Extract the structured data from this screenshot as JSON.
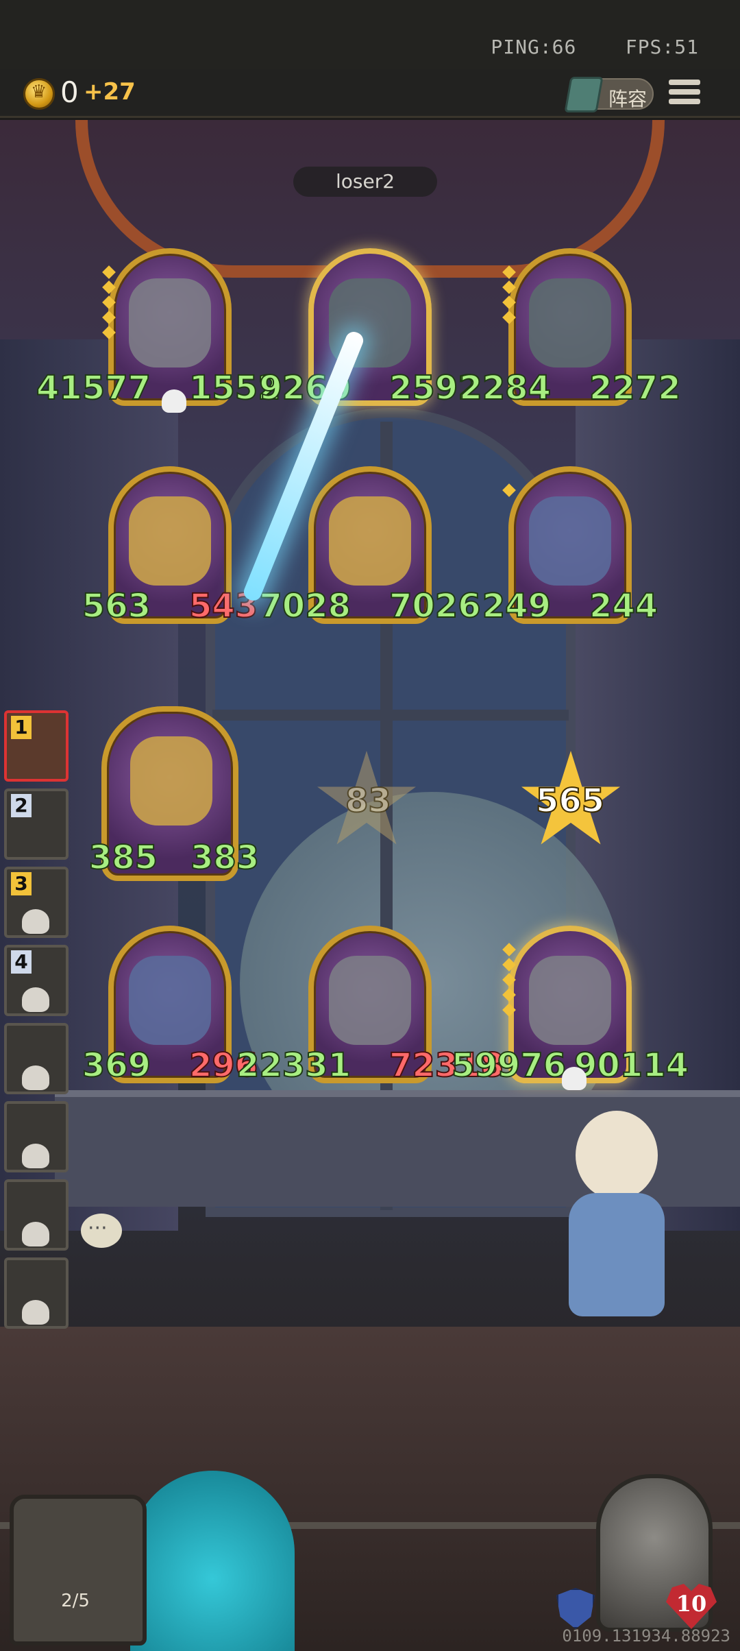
{
  "status": {
    "ping": "PING:66",
    "fps": "FPS:51"
  },
  "hud": {
    "gold": "0",
    "income": "+27",
    "lineup_label": "阵容"
  },
  "opponent": {
    "name": "loser2"
  },
  "board": {
    "enemy_row_1": [
      {
        "attack": "41577",
        "health": "1552",
        "dead": true
      },
      {
        "attack": "9260",
        "health": "2592",
        "dead": false
      },
      {
        "attack": "2284",
        "health": "2272",
        "dead": false
      }
    ],
    "enemy_row_2": [
      {
        "attack": "563",
        "health": "543",
        "dead": false
      },
      {
        "attack": "7028",
        "health": "7026",
        "dead": false
      },
      {
        "attack": "249",
        "health": "244",
        "dead": false
      }
    ],
    "player_active": {
      "attack": "385",
      "health": "383"
    },
    "player_row": [
      {
        "attack": "369",
        "health": "296"
      },
      {
        "attack": "22331",
        "health": "72318",
        "dead": false
      },
      {
        "attack": "59976",
        "health": "90114",
        "dead": true
      }
    ],
    "damage_faded": "83",
    "damage_bright": "565"
  },
  "side_list": [
    {
      "rank": "1",
      "dead": false
    },
    {
      "rank": "2",
      "dead": false
    },
    {
      "rank": "3",
      "dead": true
    },
    {
      "rank": "4",
      "dead": true
    },
    {
      "rank": "",
      "dead": true
    },
    {
      "rank": "",
      "dead": true
    },
    {
      "rank": "",
      "dead": true
    },
    {
      "rank": "",
      "dead": true
    }
  ],
  "bottom": {
    "deck_count": "2/5",
    "player_health": "10",
    "build_id": "0109.131934.88923"
  },
  "colors": {
    "gold": "#f2c23a",
    "stat_green": "#a8ee82",
    "stat_red": "#ff6a6a",
    "card_border": "#c99a2c"
  }
}
